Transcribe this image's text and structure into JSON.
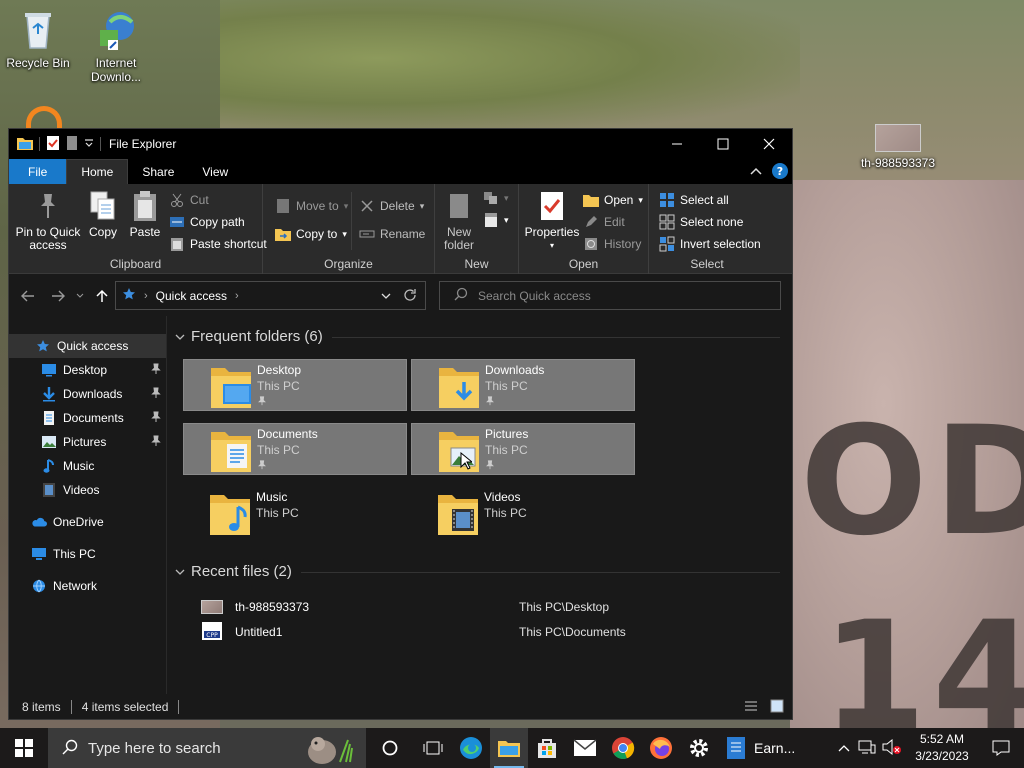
{
  "desktop": {
    "icons": [
      {
        "label": "Recycle Bin"
      },
      {
        "label": "Internet Downlo..."
      },
      {
        "label": "th-988593373"
      }
    ],
    "wallpaper_text": [
      "ODT",
      "14"
    ]
  },
  "window": {
    "title": "File Explorer",
    "tabs": {
      "file": "File",
      "home": "Home",
      "share": "Share",
      "view": "View"
    },
    "ribbon": {
      "clipboard": {
        "label": "Clipboard",
        "pin": "Pin to Quick access",
        "copy": "Copy",
        "paste": "Paste",
        "cut": "Cut",
        "copy_path": "Copy path",
        "paste_shortcut": "Paste shortcut"
      },
      "organize": {
        "label": "Organize",
        "move_to": "Move to",
        "copy_to": "Copy to",
        "delete": "Delete",
        "rename": "Rename"
      },
      "new": {
        "label": "New",
        "new_folder": "New folder"
      },
      "open": {
        "label": "Open",
        "properties": "Properties",
        "open": "Open",
        "edit": "Edit",
        "history": "History"
      },
      "select": {
        "label": "Select",
        "select_all": "Select all",
        "select_none": "Select none",
        "invert": "Invert selection"
      }
    },
    "address": {
      "location": "Quick access"
    },
    "search": {
      "placeholder": "Search Quick access"
    },
    "nav": {
      "quick_access": "Quick access",
      "items": [
        {
          "label": "Desktop",
          "pinned": true
        },
        {
          "label": "Downloads",
          "pinned": true
        },
        {
          "label": "Documents",
          "pinned": true
        },
        {
          "label": "Pictures",
          "pinned": true
        },
        {
          "label": "Music",
          "pinned": false
        },
        {
          "label": "Videos",
          "pinned": false
        }
      ],
      "onedrive": "OneDrive",
      "this_pc": "This PC",
      "network": "Network"
    },
    "frequent": {
      "heading": "Frequent folders (6)",
      "folders": [
        {
          "name": "Desktop",
          "location": "This PC",
          "selected": true
        },
        {
          "name": "Downloads",
          "location": "This PC",
          "selected": true
        },
        {
          "name": "Documents",
          "location": "This PC",
          "selected": true
        },
        {
          "name": "Pictures",
          "location": "This PC",
          "selected": true
        },
        {
          "name": "Music",
          "location": "This PC",
          "selected": false
        },
        {
          "name": "Videos",
          "location": "This PC",
          "selected": false
        }
      ]
    },
    "recent": {
      "heading": "Recent files (2)",
      "files": [
        {
          "name": "th-988593373",
          "path": "This PC\\Desktop"
        },
        {
          "name": "Untitled1",
          "path": "This PC\\Documents"
        }
      ]
    },
    "status": {
      "items": "8 items",
      "selected": "4 items selected"
    }
  },
  "taskbar": {
    "search_placeholder": "Type here to search",
    "word_app": "Earn...",
    "time": "5:52 AM",
    "date": "3/23/2023"
  },
  "colors": {
    "accent": "#1979ca",
    "folder": "#f4c552",
    "selected_tile": "#777777"
  }
}
